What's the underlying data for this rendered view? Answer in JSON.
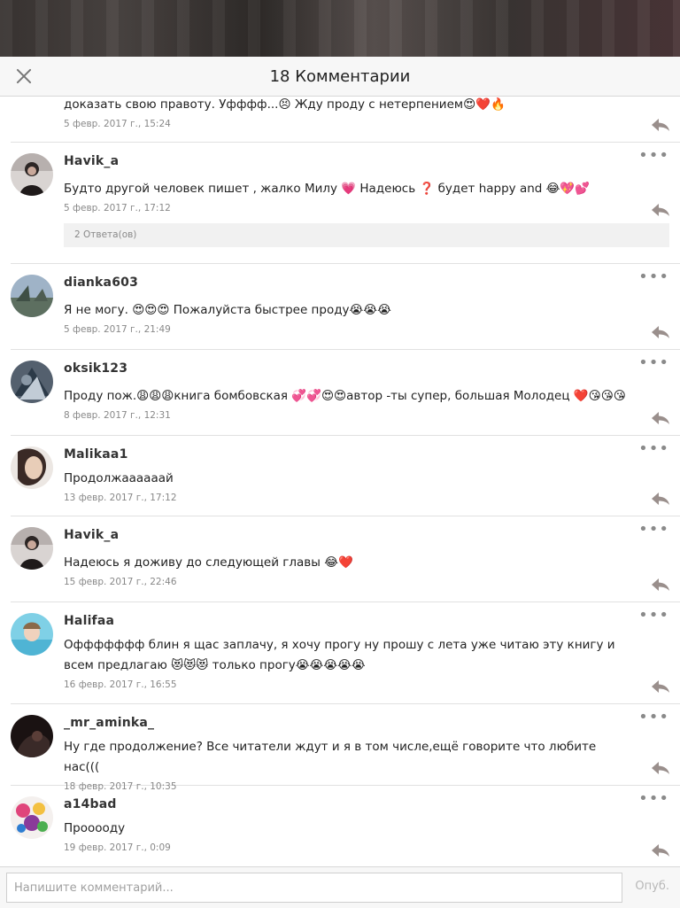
{
  "header": {
    "title": "18 Комментарии"
  },
  "comments": [
    {
      "text": "доказать свою правоту. Уфффф...😣 Жду проду с нетерпением😍❤️🔥",
      "date": "5 февр. 2017 г., 15:24"
    },
    {
      "username": "Havik_a",
      "text": "Будто другой человек пишет , жалко Милу 💗 Надеюсь ❓ будет happy and 😂💖💕",
      "date": "5 февр. 2017 г., 17:12",
      "replies": "2 Ответа(ов)"
    },
    {
      "username": "dianka603",
      "text": "Я не могу. 😍😍😍 Пожалуйста быстрее проду😭😭😭",
      "date": "5 февр. 2017 г., 21:49"
    },
    {
      "username": "oksik123",
      "text": "Проду пож.😩😩😩книга бомбовская 💞💞😍😍автор -ты супер, большая Молодец ❤️😘😘😘",
      "date": "8 февр. 2017 г., 12:31"
    },
    {
      "username": "Malikaa1",
      "text": "Продолжаааааай",
      "date": "13 февр. 2017 г., 17:12"
    },
    {
      "username": "Havik_a",
      "text": "Надеюсь я доживу до следующей главы 😂❤️",
      "date": "15 февр. 2017 г., 22:46"
    },
    {
      "username": "Halifaa",
      "text": "Оффффффф блин я щас заплачу, я хочу прогу ну прошу с лета уже читаю эту книгу и всем предлагаю 😻😻😻 только прогу😭😭😭😭😭",
      "date": "16 февр. 2017 г., 16:55"
    },
    {
      "username": "_mr_aminka_",
      "text": "Ну где продолжение? Все читатели ждут и я в том числе,ещё говорите что любите нас(((",
      "date": "18 февр. 2017 г., 10:35"
    },
    {
      "username": "a14bad",
      "text": "Прооооду",
      "date": "19 февр. 2017 г., 0:09"
    }
  ],
  "footer": {
    "placeholder": "Напишите комментарий...",
    "send_label": "Опуб."
  },
  "icons": {
    "close": "close-icon",
    "more": "more-dots-icon",
    "reply": "reply-arrow-icon"
  },
  "colors": {
    "header_bg": "#f7f7f7",
    "divider": "#e1e1e1",
    "reply_icon": "#9a8f8c"
  }
}
